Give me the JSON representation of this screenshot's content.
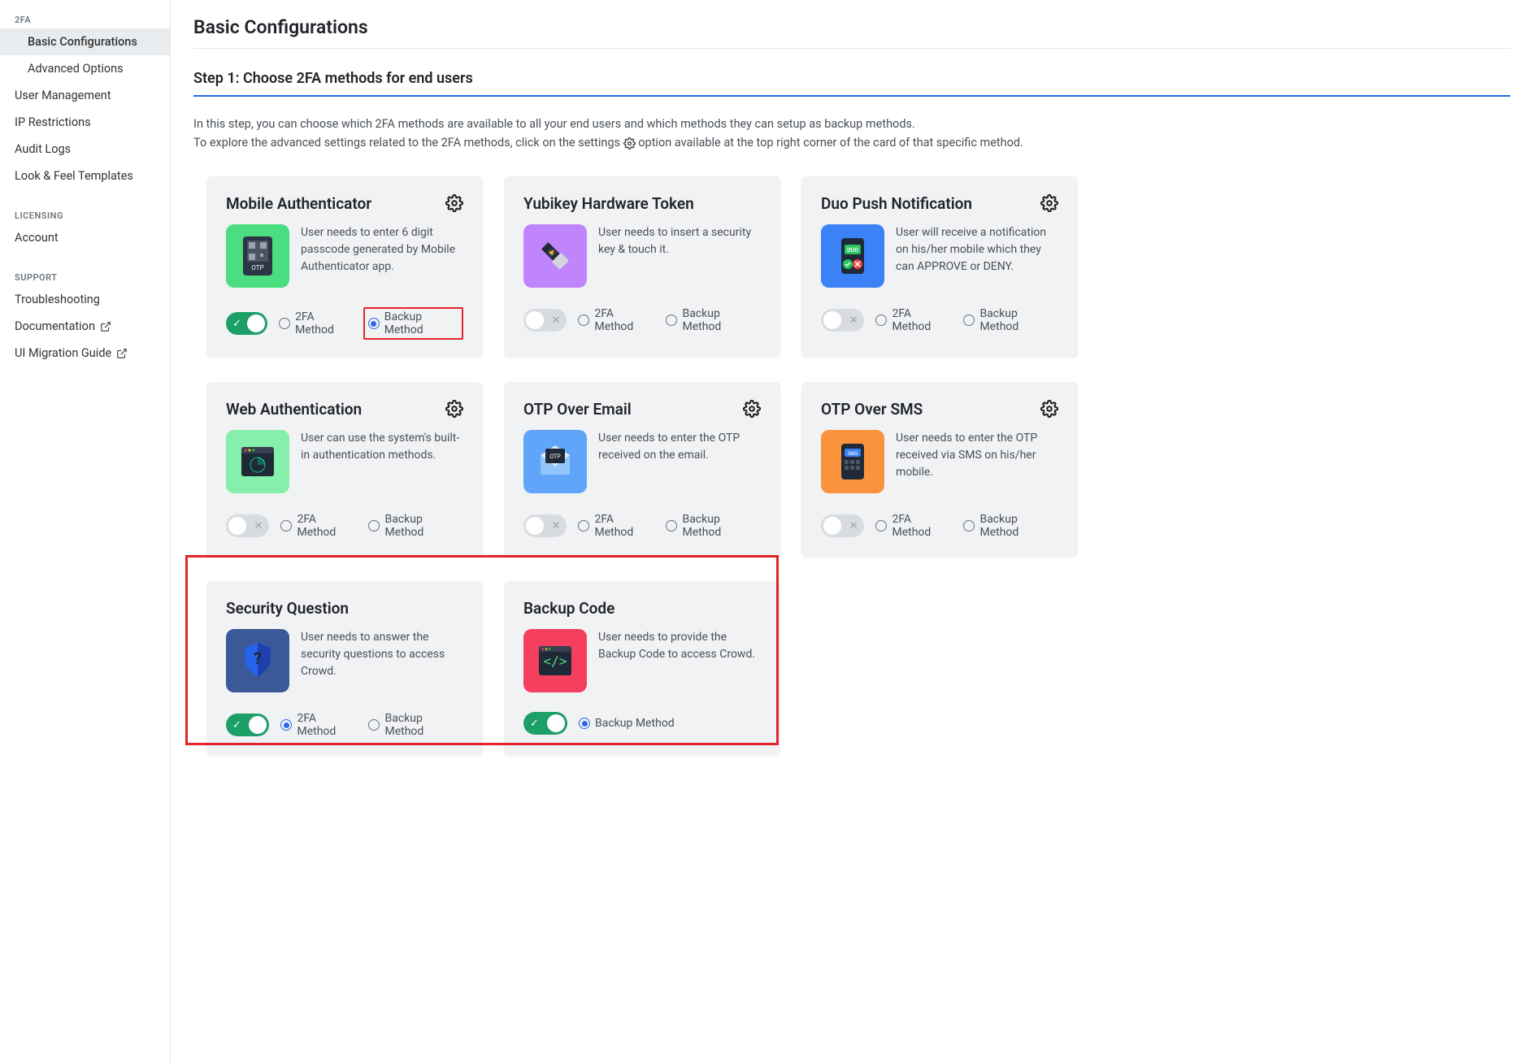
{
  "sidebar": {
    "section_2fa": "2FA",
    "items_2fa": [
      {
        "label": "Basic Configurations",
        "active": true
      },
      {
        "label": "Advanced Options",
        "active": false
      }
    ],
    "items_main": [
      "User Management",
      "IP Restrictions",
      "Audit Logs",
      "Look & Feel Templates"
    ],
    "section_licensing": "LICENSING",
    "items_licensing": [
      "Account"
    ],
    "section_support": "SUPPORT",
    "items_support": [
      {
        "label": "Troubleshooting",
        "external": false
      },
      {
        "label": "Documentation",
        "external": true
      },
      {
        "label": "UI Migration Guide",
        "external": true
      }
    ]
  },
  "page": {
    "title": "Basic Configurations",
    "step_title": "Step 1: Choose 2FA methods for end users",
    "intro_line1": "In this step, you can choose which 2FA methods are available to all your end users and which methods they can setup as backup methods.",
    "intro_line2_a": "To explore the advanced settings related to the 2FA methods, click on the settings",
    "intro_line2_b": "option available at the top right corner of the card of that specific method."
  },
  "labels": {
    "method_2fa": "2FA Method",
    "method_backup": "Backup Method"
  },
  "cards": [
    {
      "id": "mobile-auth",
      "title": "Mobile Authenticator",
      "desc": "User needs to enter 6 digit passcode generated by Mobile Authenticator app.",
      "icon_bg": "#4ade80",
      "has_gear": true,
      "toggle_on": true,
      "radio_2fa": false,
      "radio_backup": true,
      "backup_highlighted": true
    },
    {
      "id": "yubikey",
      "title": "Yubikey Hardware Token",
      "desc": "User needs to insert a security key & touch it.",
      "icon_bg": "#c084fc",
      "has_gear": false,
      "toggle_on": false,
      "radio_2fa": false,
      "radio_backup": false
    },
    {
      "id": "duo-push",
      "title": "Duo Push Notification",
      "desc": "User will receive a notification on his/her mobile which they can APPROVE or DENY.",
      "icon_bg": "#3b82f6",
      "has_gear": true,
      "toggle_on": false,
      "radio_2fa": false,
      "radio_backup": false
    },
    {
      "id": "web-auth",
      "title": "Web Authentication",
      "desc": "User can use the system's built-in authentication methods.",
      "icon_bg": "#86efac",
      "has_gear": true,
      "toggle_on": false,
      "radio_2fa": false,
      "radio_backup": false
    },
    {
      "id": "otp-email",
      "title": "OTP Over Email",
      "desc": "User needs to enter the OTP received on the email.",
      "icon_bg": "#60a5fa",
      "has_gear": true,
      "toggle_on": false,
      "radio_2fa": false,
      "radio_backup": false
    },
    {
      "id": "otp-sms",
      "title": "OTP Over SMS",
      "desc": "User needs to enter the OTP received via SMS on his/her mobile.",
      "icon_bg": "#fb923c",
      "has_gear": true,
      "toggle_on": false,
      "radio_2fa": false,
      "radio_backup": false
    },
    {
      "id": "security-question",
      "title": "Security Question",
      "desc": "User needs to answer the security questions to access Crowd.",
      "icon_bg": "#3b5998",
      "has_gear": false,
      "toggle_on": true,
      "radio_2fa": true,
      "radio_backup": false
    },
    {
      "id": "backup-code",
      "title": "Backup Code",
      "desc": "User needs to provide the Backup Code to access Crowd.",
      "icon_bg": "#f43f5e",
      "has_gear": false,
      "toggle_on": true,
      "only_backup": true,
      "radio_backup": true
    }
  ]
}
